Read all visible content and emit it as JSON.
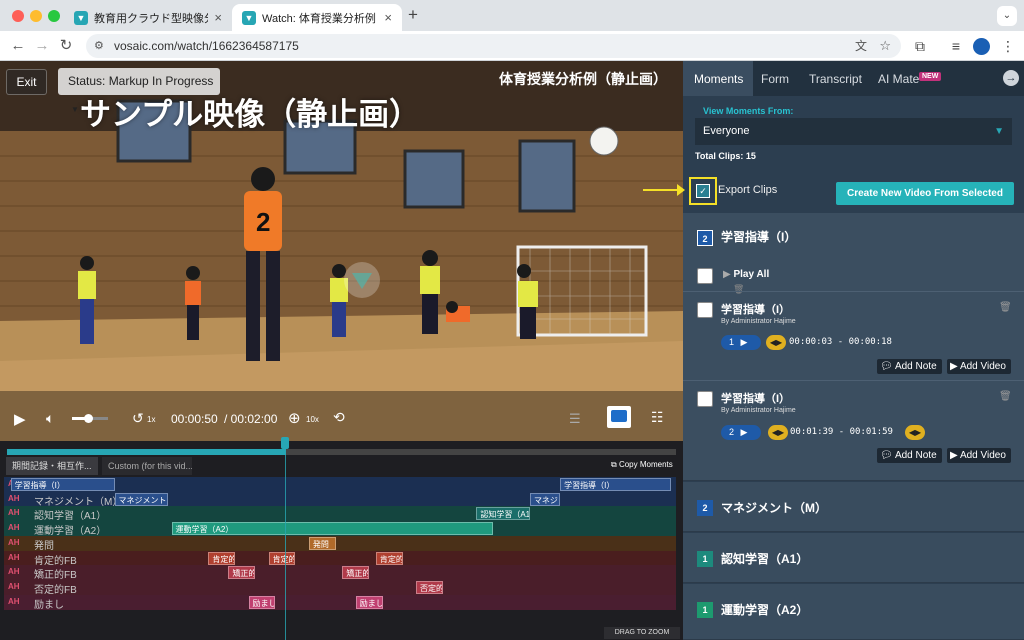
{
  "browser": {
    "tabs": [
      {
        "label": "教育用クラウド型映像分析ソフト",
        "active": false
      },
      {
        "label": "Watch: 体育授業分析例（静止画）",
        "active": true
      }
    ],
    "url": "vosaic.com/watch/1662364587175"
  },
  "video": {
    "exit_label": "Exit",
    "status_label": "Status: Markup In Progress",
    "title": "体育授業分析例（静止画）",
    "overlay_text": "サンプル映像（静止画）",
    "rewind_label": "1x",
    "current_time": "00:00:50",
    "total_time": "/ 00:02:00",
    "zoom_label": "10x",
    "volume_level": 0.45
  },
  "timeline": {
    "tabs": [
      "期間記録・相互作...",
      "Custom (for this vid..."
    ],
    "copy_label": "Copy Moments",
    "drag_label": "DRAG TO ZOOM",
    "rows": [
      {
        "ah": "AH",
        "label": "学習指導（I）",
        "color": "#2a4f8c",
        "row_bg": "#1b2f52",
        "bars": [
          {
            "label": "学習指導（I）",
            "start": 0.01,
            "end": 0.165
          },
          {
            "label": "学習指導（I）",
            "start": 0.83,
            "end": 0.995
          }
        ]
      },
      {
        "ah": "AH",
        "label": "マネジメント（M）",
        "color": "#2a4f8c",
        "row_bg": "#1b2f52",
        "bars": [
          {
            "label": "マネジメント（",
            "start": 0.165,
            "end": 0.245
          },
          {
            "label": "マネジ",
            "start": 0.785,
            "end": 0.83
          }
        ]
      },
      {
        "ah": "AH",
        "label": "認知学習（A1）",
        "color": "#1b6e6a",
        "row_bg": "#14453f",
        "bars": [
          {
            "label": "認知学習（A1）",
            "start": 0.705,
            "end": 0.785
          }
        ]
      },
      {
        "ah": "AH",
        "label": "運動学習（A2）",
        "color": "#1f9a7e",
        "row_bg": "#14453f",
        "bars": [
          {
            "label": "運動学習（A2）",
            "start": 0.25,
            "end": 0.73
          }
        ]
      },
      {
        "ah": "AH",
        "label": "発問",
        "color": "#b06a2a",
        "row_bg": "#4a3018",
        "bars": [
          {
            "label": "発問",
            "start": 0.455,
            "end": 0.495
          }
        ]
      },
      {
        "ah": "AH",
        "label": "肯定的FB",
        "color": "#b04030",
        "row_bg": "#4a1e1e",
        "bars": [
          {
            "label": "肯定的F",
            "start": 0.305,
            "end": 0.345
          },
          {
            "label": "肯定的F",
            "start": 0.395,
            "end": 0.435
          },
          {
            "label": "肯定的F",
            "start": 0.555,
            "end": 0.595
          }
        ]
      },
      {
        "ah": "AH",
        "label": "矯正的FB",
        "color": "#b03a4a",
        "row_bg": "#4a1e2a",
        "bars": [
          {
            "label": "矯正的F",
            "start": 0.335,
            "end": 0.375
          },
          {
            "label": "矯正的F",
            "start": 0.505,
            "end": 0.545
          }
        ]
      },
      {
        "ah": "AH",
        "label": "否定的FB",
        "color": "#b03a4a",
        "row_bg": "#4a1e2a",
        "bars": [
          {
            "label": "否定的F",
            "start": 0.615,
            "end": 0.655
          }
        ]
      },
      {
        "ah": "AH",
        "label": "励まし",
        "color": "#c04070",
        "row_bg": "#4a1e30",
        "bars": [
          {
            "label": "励まし",
            "start": 0.365,
            "end": 0.405
          },
          {
            "label": "励まし",
            "start": 0.525,
            "end": 0.565
          }
        ]
      }
    ],
    "playhead": 0.417
  },
  "sidebar": {
    "tabs": [
      "Moments",
      "Form",
      "Transcript",
      "AI Mate"
    ],
    "new_badge": "NEW",
    "view_from_label": "View Moments From:",
    "view_from_value": "Everyone",
    "total_clips_label": "Total Clips:",
    "total_clips_value": "15",
    "export_label": "Export Clips",
    "create_button": "Create New Video From Selected",
    "category_expanded": {
      "num": "2",
      "label": "学習指導（I）",
      "color": "#1e5aa8"
    },
    "play_all_label": "Play All",
    "clips": [
      {
        "title": "学習指導（I）",
        "author": "By Administrator Hajime",
        "num": "1",
        "time": "00:00:03 - 00:00:18",
        "note_label": "Add Note",
        "video_label": "Add Video"
      },
      {
        "title": "学習指導（I）",
        "author": "By Administrator Hajime",
        "num": "2",
        "time": "00:01:39 - 00:01:59",
        "note_label": "Add Note",
        "video_label": "Add Video"
      }
    ],
    "categories": [
      {
        "num": "2",
        "label": "マネジメント（M）",
        "color": "#1e5aa8"
      },
      {
        "num": "1",
        "label": "認知学習（A1）",
        "color": "#1d8a7d"
      },
      {
        "num": "1",
        "label": "運動学習（A2）",
        "color": "#1d9a6f"
      }
    ]
  },
  "colors": {
    "accent": "#28a7b5",
    "highlight": "#f5e027"
  }
}
